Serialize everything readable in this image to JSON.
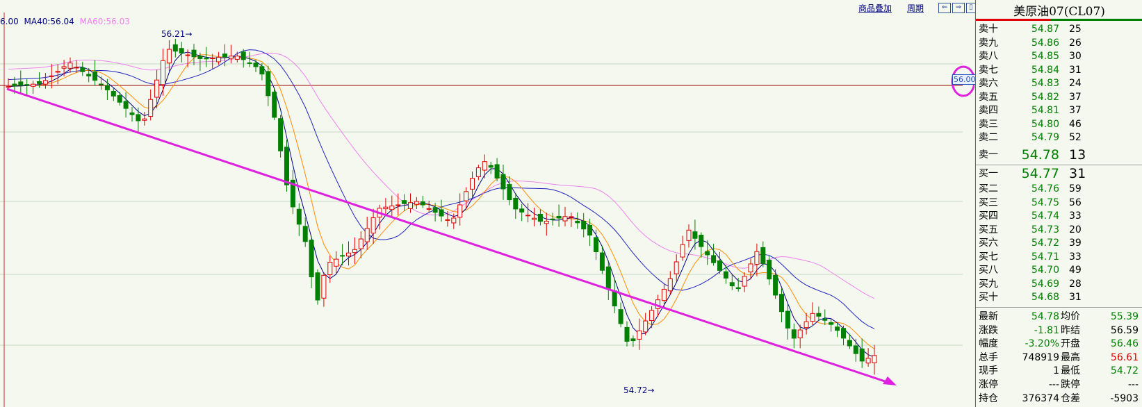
{
  "legend": {
    "ma1": "6.00",
    "ma2": "MA40:56.04",
    "ma3": "MA60:56.03"
  },
  "toolbar": {
    "overlay": "商品叠加",
    "period": "周期"
  },
  "annotations": {
    "high_label": "56.21→",
    "low_label": "54.72→",
    "price_tag": "56.00"
  },
  "panel": {
    "title": "美原油07(CL07)",
    "asks": [
      {
        "label": "卖十",
        "price": "54.87",
        "vol": "25"
      },
      {
        "label": "卖九",
        "price": "54.86",
        "vol": "26"
      },
      {
        "label": "卖八",
        "price": "54.85",
        "vol": "30"
      },
      {
        "label": "卖七",
        "price": "54.84",
        "vol": "31"
      },
      {
        "label": "卖六",
        "price": "54.83",
        "vol": "24"
      },
      {
        "label": "卖五",
        "price": "54.82",
        "vol": "37"
      },
      {
        "label": "卖四",
        "price": "54.81",
        "vol": "37"
      },
      {
        "label": "卖三",
        "price": "54.80",
        "vol": "46"
      },
      {
        "label": "卖二",
        "price": "54.79",
        "vol": "52"
      },
      {
        "label": "卖一",
        "price": "54.78",
        "vol": "13"
      }
    ],
    "bids": [
      {
        "label": "买一",
        "price": "54.77",
        "vol": "31"
      },
      {
        "label": "买二",
        "price": "54.76",
        "vol": "59"
      },
      {
        "label": "买三",
        "price": "54.75",
        "vol": "56"
      },
      {
        "label": "买四",
        "price": "54.74",
        "vol": "33"
      },
      {
        "label": "买五",
        "price": "54.73",
        "vol": "20"
      },
      {
        "label": "买六",
        "price": "54.72",
        "vol": "39"
      },
      {
        "label": "买七",
        "price": "54.71",
        "vol": "33"
      },
      {
        "label": "买八",
        "price": "54.70",
        "vol": "49"
      },
      {
        "label": "买九",
        "price": "54.69",
        "vol": "28"
      },
      {
        "label": "买十",
        "price": "54.68",
        "vol": "31"
      }
    ],
    "stats": [
      {
        "l1": "最新",
        "v1": "54.78",
        "c1": "g",
        "l2": "均价",
        "v2": "55.39",
        "c2": "g"
      },
      {
        "l1": "涨跌",
        "v1": "-1.81",
        "c1": "g",
        "l2": "昨结",
        "v2": "56.59",
        "c2": "k"
      },
      {
        "l1": "幅度",
        "v1": "-3.20%",
        "c1": "g",
        "l2": "开盘",
        "v2": "56.46",
        "c2": "g"
      },
      {
        "l1": "总手",
        "v1": "748919",
        "c1": "k",
        "l2": "最高",
        "v2": "56.61",
        "c2": "r"
      },
      {
        "l1": "现手",
        "v1": "1",
        "c1": "k",
        "l2": "最低",
        "v2": "54.72",
        "c2": "g"
      },
      {
        "l1": "涨停",
        "v1": "---",
        "c1": "k",
        "l2": "跌停",
        "v2": "---",
        "c2": "k"
      },
      {
        "l1": "持仓",
        "v1": "376374",
        "c1": "k",
        "l2": "仓差",
        "v2": "-5903",
        "c2": "k"
      }
    ]
  },
  "colors": {
    "up": "#e00000",
    "down": "#008000",
    "ma_short": "#000080",
    "ma_mid": "#ff8c00",
    "ma_long1": "#2020c0",
    "ma_long2": "#ee82ee",
    "trend": "#e020e0",
    "hline": "#a00000"
  }
}
